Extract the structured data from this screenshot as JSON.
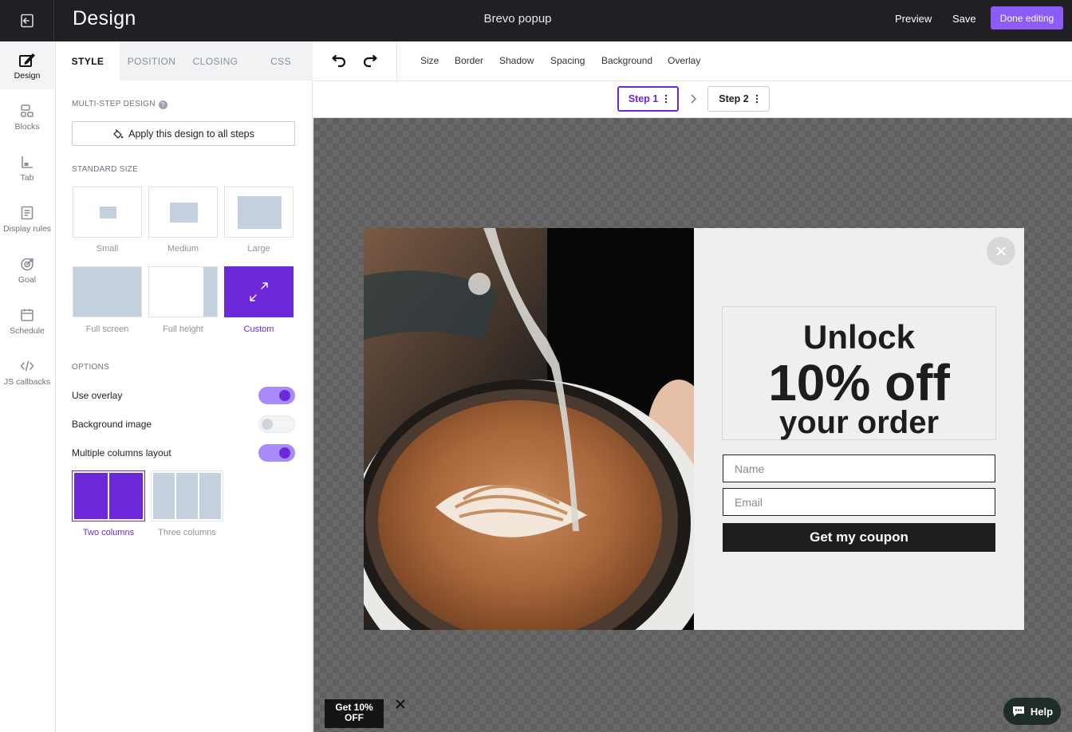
{
  "topbar": {
    "exit_icon": "exit-icon",
    "app_title": "Design",
    "doc_title": "Brevo popup",
    "preview_label": "Preview",
    "save_label": "Save",
    "done_label": "Done editing",
    "done_color": "#8b5cf6"
  },
  "nav": {
    "items": [
      {
        "label": "Design",
        "icon": "design-icon"
      },
      {
        "label": "Blocks",
        "icon": "blocks-icon"
      },
      {
        "label": "Tab",
        "icon": "tab-icon"
      },
      {
        "label": "Display rules",
        "icon": "display-rules-icon"
      },
      {
        "label": "Goal",
        "icon": "goal-icon"
      },
      {
        "label": "Schedule",
        "icon": "schedule-icon"
      },
      {
        "label": "JS callbacks",
        "icon": "code-icon"
      }
    ]
  },
  "panel": {
    "tabs": [
      "STYLE",
      "POSITION",
      "CLOSING",
      "CSS"
    ],
    "active_tab": "STYLE",
    "multistep_label": "MULTI-STEP DESIGN",
    "apply_label": "Apply this design to all steps",
    "standard_size_label": "STANDARD SIZE",
    "sizes": [
      {
        "label": "Small"
      },
      {
        "label": "Medium"
      },
      {
        "label": "Large"
      },
      {
        "label": "Full screen"
      },
      {
        "label": "Full height"
      },
      {
        "label": "Custom"
      }
    ],
    "selected_size": "Custom",
    "options_label": "OPTIONS",
    "options": [
      {
        "label": "Use overlay",
        "on": true
      },
      {
        "label": "Background image",
        "on": false
      },
      {
        "label": "Multiple columns layout",
        "on": true
      }
    ],
    "columns": [
      {
        "label": "Two columns"
      },
      {
        "label": "Three columns"
      }
    ],
    "selected_columns": "Two columns",
    "accent_color": "#6d28d9"
  },
  "toolbar": {
    "undo_icon": "undo-icon",
    "redo_icon": "redo-icon",
    "links": [
      "Size",
      "Border",
      "Shadow",
      "Spacing",
      "Background",
      "Overlay"
    ]
  },
  "steps": {
    "items": [
      {
        "label": "Step 1",
        "active": true
      },
      {
        "label": "Step 2",
        "active": false
      }
    ]
  },
  "popup": {
    "headline_1": "Unlock",
    "headline_2": "10% off",
    "headline_3": "your order",
    "name_placeholder": "Name",
    "email_placeholder": "Email",
    "cta_label": "Get my coupon",
    "image": "latte-art-coffee-photo"
  },
  "teaser": {
    "line1": "Get 10%",
    "line2": "OFF"
  },
  "help": {
    "label": "Help"
  }
}
